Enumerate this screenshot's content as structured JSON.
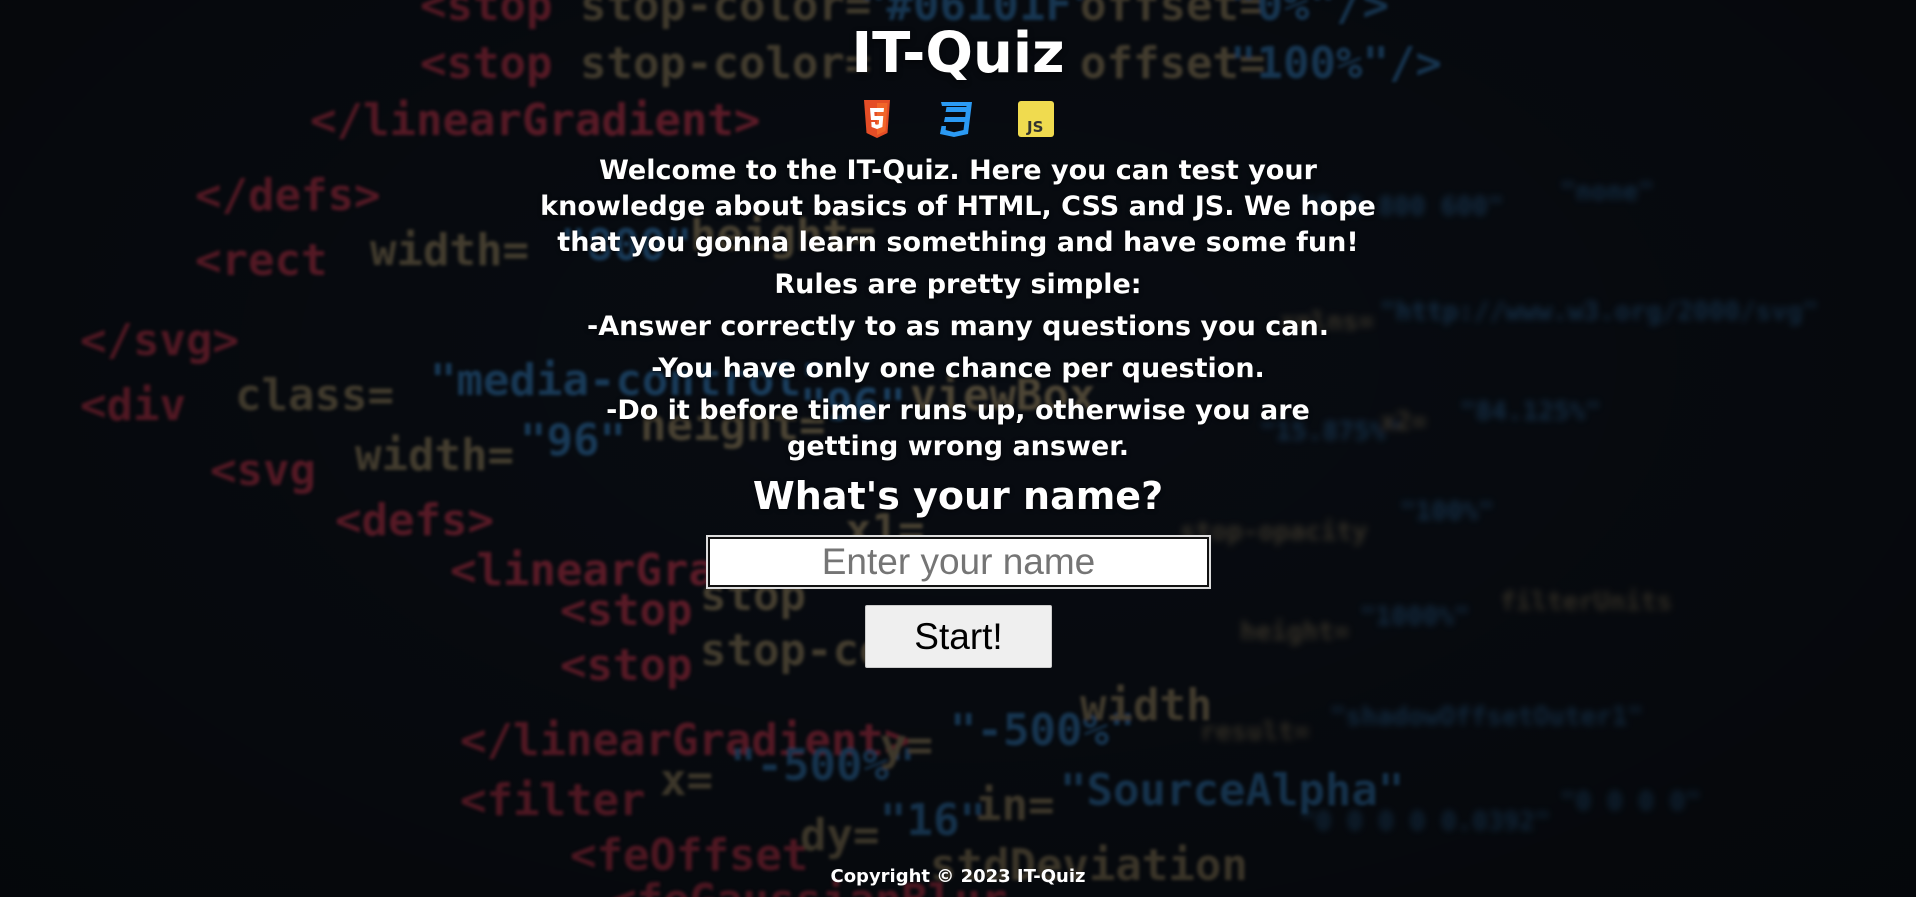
{
  "page": {
    "title": "IT-Quiz",
    "icons": [
      "html5-icon",
      "css3-icon",
      "javascript-icon"
    ],
    "intro": "Welcome to the IT-Quiz. Here you can test your knowledge about basics of HTML, CSS and JS. We hope that you gonna learn something and have some fun!",
    "rules_heading": "Rules are pretty simple:",
    "rules": [
      "-Answer correctly to as many questions you can.",
      "-You have only one chance per question.",
      "-Do it before timer runs up, otherwise you are getting wrong answer."
    ],
    "name_prompt": "What's your name?",
    "name_input": {
      "value": "",
      "placeholder": "Enter your name"
    },
    "start_button": "Start!",
    "footer": "Copyright © 2023 IT-Quiz"
  },
  "colors": {
    "html5": "#e44d26",
    "css3": "#2b9af3",
    "javascript": "#f0db4f"
  }
}
